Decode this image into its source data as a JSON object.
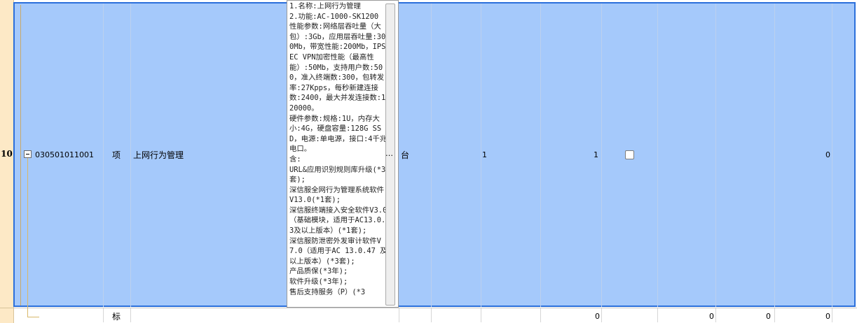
{
  "row": {
    "number": "10",
    "code": "030501011001",
    "kind": "项",
    "name": "上网行为管理",
    "description": "1.名称:上网行为管理\n2.功能:AC-1000-SK1200\n性能参数:网络层吞吐量（大包）:3Gb，应用层吞吐量:300Mb，带宽性能:200Mb，IPSEC VPN加密性能（最高性能）:50Mb，支持用户数:500，准入终端数:300，包转发率:27Kpps，每秒新建连接数:2400，最大并发连接数:120000。\n硬件参数:规格:1U，内存大小:4G，硬盘容量:128G SSD，电源:单电源，接口:4千兆电口。\n含:\nURL&应用识别规则库升级(*3套);\n深信服全网行为管理系统软件V13.0(*1套);\n深信服终端接入安全软件V3.0（基础模块，适用于AC13.0.3及以上版本）(*1套);\n深信服防泄密外发审计软件V7.0（适用于AC 13.0.47 及以上版本）(*3套);\n产品质保(*3年);\n软件升级(*3年);\n售后支持服务（P）(*3",
    "ellipsis": "…",
    "unit": "台",
    "qty1": "1",
    "qty2": "1",
    "last_value": "0"
  },
  "subrow": {
    "kind": "标",
    "values": [
      "0",
      "0",
      "0",
      "0"
    ]
  },
  "colors": {
    "selection": "#a5c9fb",
    "selection_border": "#2b6fdb",
    "row_header": "#fde9c6"
  }
}
